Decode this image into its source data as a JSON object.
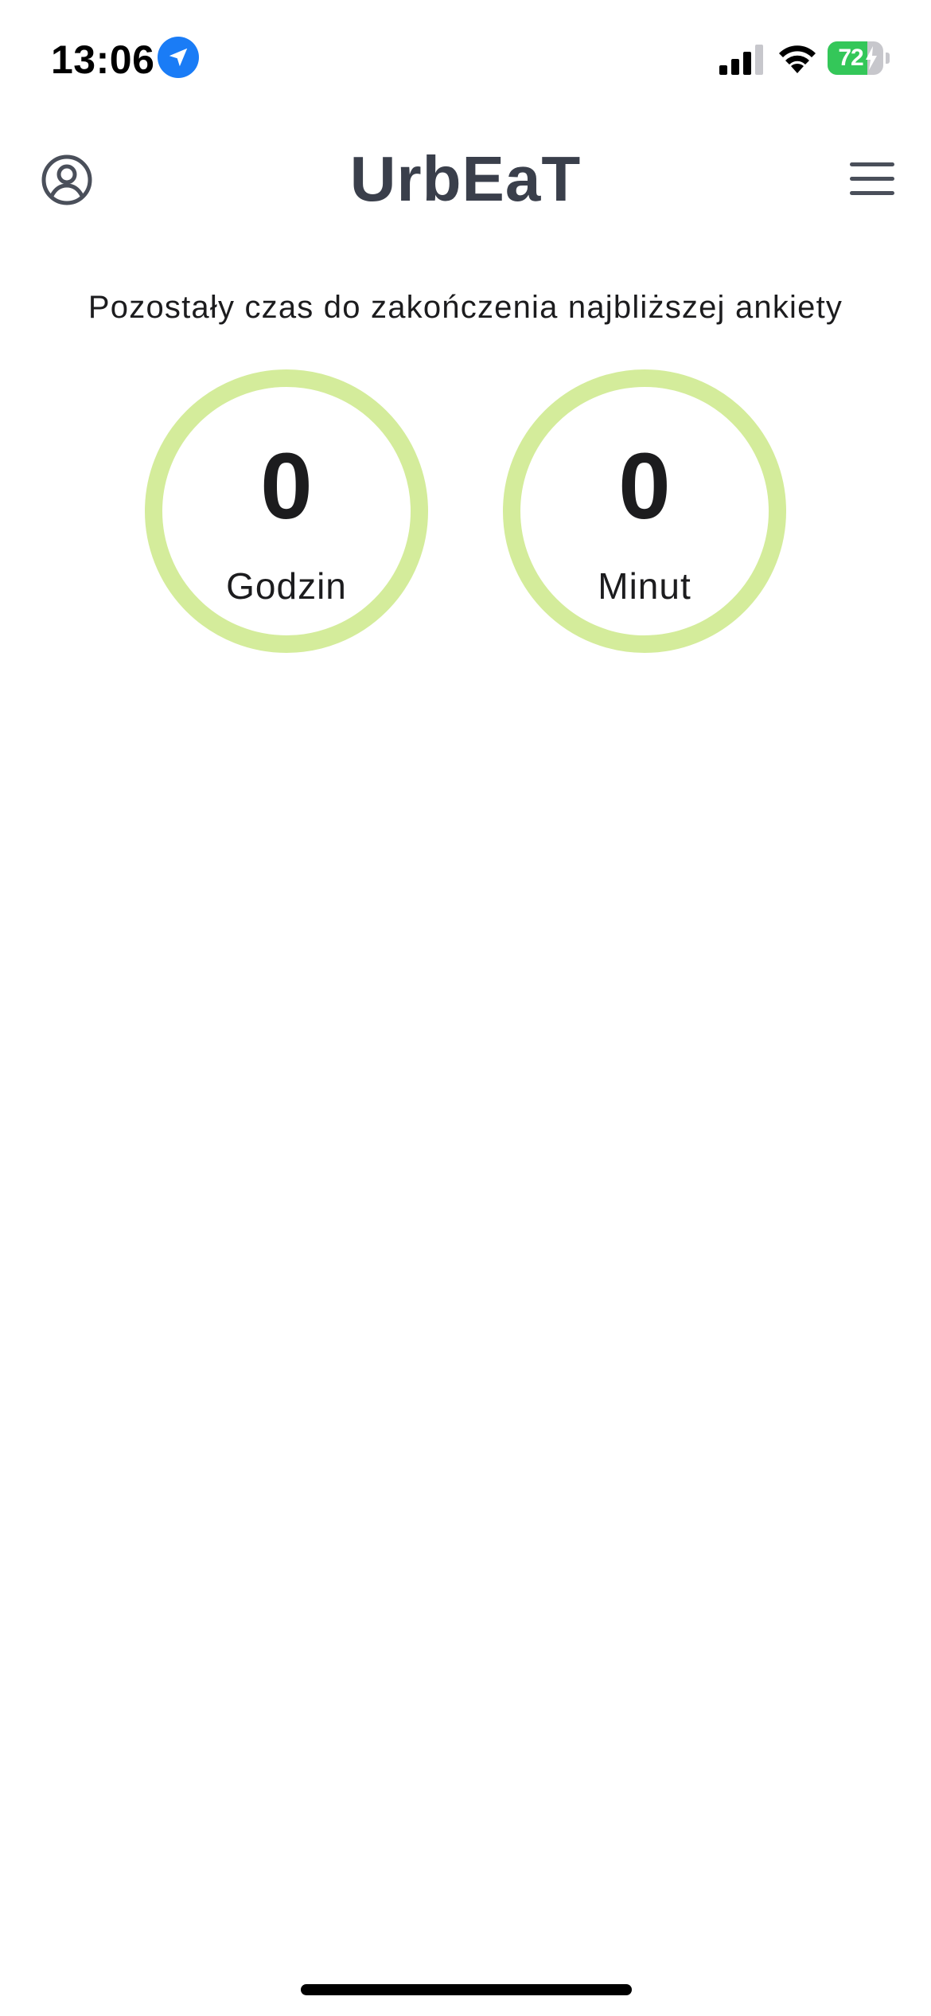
{
  "status_bar": {
    "time": "13:06",
    "battery_level": "72",
    "battery_fraction": 0.72,
    "battery_charging": true,
    "signal_bars_active": 3,
    "signal_bars_total": 4,
    "icons": [
      "location-arrow-icon",
      "cellular-signal-icon",
      "wifi-icon",
      "battery-charging-icon"
    ]
  },
  "header": {
    "title": "UrbEaT",
    "left_icon": "user-circle-icon",
    "right_icon": "hamburger-menu-icon"
  },
  "countdown": {
    "caption": "Pozostały czas do zakończenia najbliższej ankiety",
    "hours": {
      "value": "0",
      "label": "Godzin"
    },
    "minutes": {
      "value": "0",
      "label": "Minut"
    },
    "ring_color": "#d4ec9b"
  },
  "colors": {
    "title": "#3a3f4b",
    "location_badge": "#1a7cf6",
    "battery_fill": "#34c759"
  }
}
